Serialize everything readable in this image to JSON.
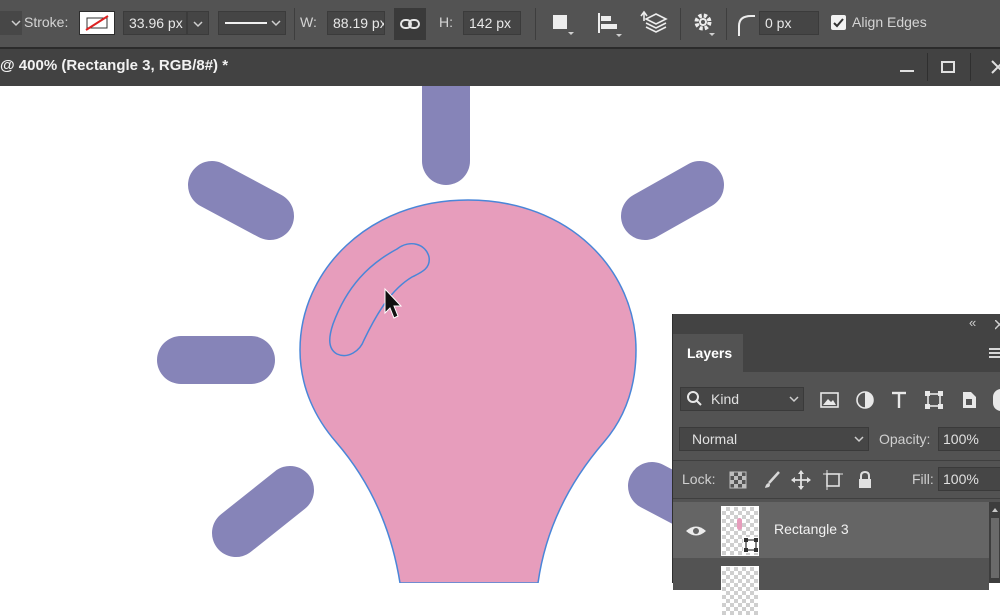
{
  "options_bar": {
    "stroke_label": "Stroke:",
    "stroke_width": "33.96 px",
    "width_label": "W:",
    "width_value": "88.19 px",
    "height_label": "H:",
    "height_value": "142 px",
    "corner_radius": "0 px",
    "align_edges_label": "Align Edges",
    "align_edges_checked": true
  },
  "document": {
    "tab_title": "@ 400% (Rectangle 3, RGB/8#) *"
  },
  "canvas": {
    "bulb_color": "#e79dbc",
    "ray_color": "#8684b8",
    "path_color": "#4a86d8",
    "background": "#ffffff"
  },
  "layers_panel": {
    "collapse_icon": "«",
    "title": "Layers",
    "filter_kind": "Kind",
    "blend_mode": "Normal",
    "opacity_label": "Opacity:",
    "opacity_value": "100%",
    "lock_label": "Lock:",
    "fill_label": "Fill:",
    "fill_value": "100%",
    "layers": [
      {
        "name": "Rectangle 3",
        "visible": true,
        "selected": true
      }
    ]
  },
  "colors": {
    "ui_dark": "#535353",
    "ui_darker": "#424242",
    "selected_row": "#656565"
  }
}
